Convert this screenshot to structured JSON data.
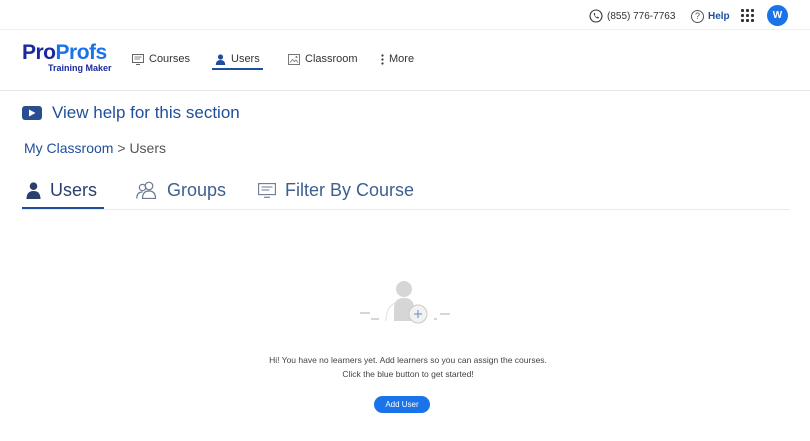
{
  "topbar": {
    "phone": "(855) 776-7763",
    "help_label": "Help",
    "avatar_initial": "W"
  },
  "logo": {
    "brand_pro": "Pro",
    "brand_profs": "Profs",
    "subtitle": "Training Maker"
  },
  "nav": {
    "courses": "Courses",
    "users": "Users",
    "classroom": "Classroom",
    "more": "More",
    "active": "users"
  },
  "help_section": {
    "label": "View help for this section",
    "icon": "play-video-icon"
  },
  "breadcrumb": {
    "root": "My Classroom",
    "separator": " > ",
    "current": "Users"
  },
  "tabs": {
    "users": "Users",
    "groups": "Groups",
    "filter_by_course": "Filter By Course",
    "active": "users"
  },
  "empty_state": {
    "line1": "Hi! You have no learners yet. Add learners so you can assign the courses.",
    "line2": "Click the blue button to get started!",
    "button": "Add User"
  },
  "colors": {
    "accent": "#1a73e8",
    "nav_active": "#1f4e9c",
    "brand_dark": "#1a2a9c"
  }
}
